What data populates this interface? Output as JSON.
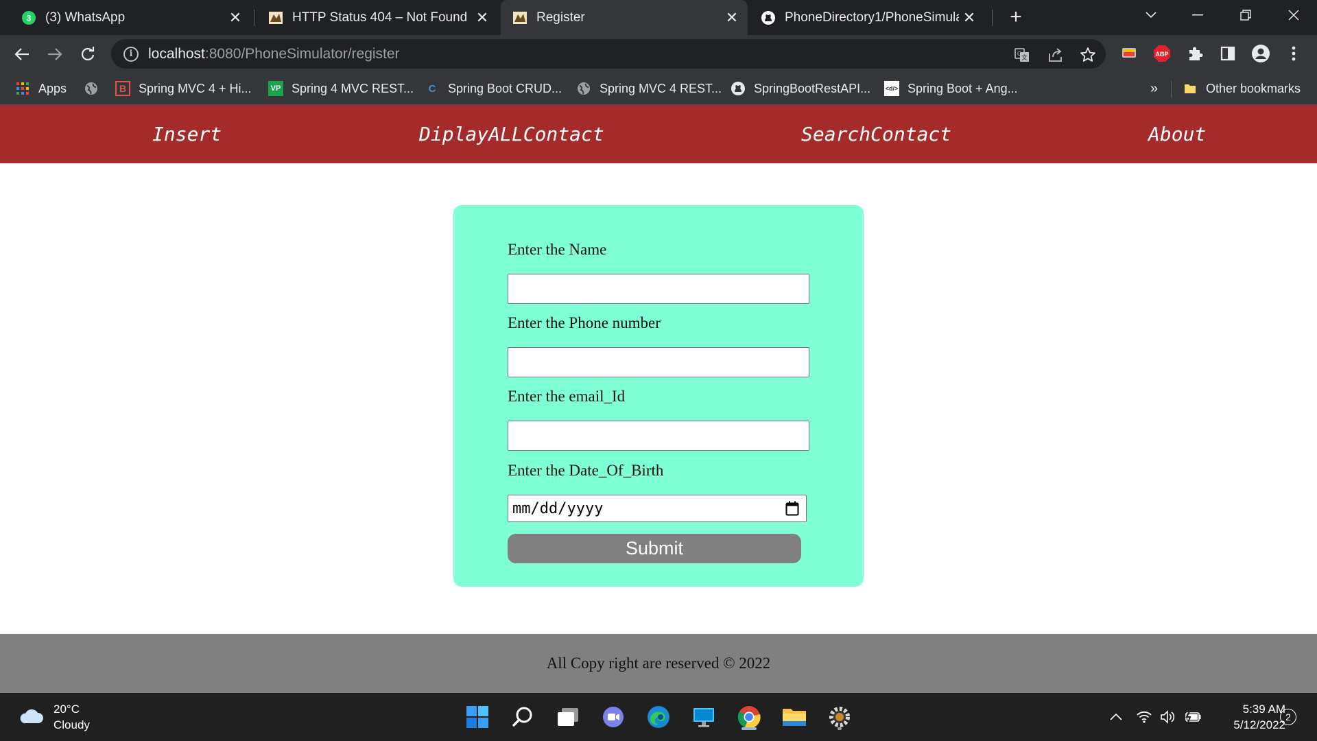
{
  "browser": {
    "tabs": [
      {
        "title": "(3) WhatsApp",
        "badge": "3",
        "favicon": "whatsapp-icon",
        "active": false
      },
      {
        "title": "HTTP Status 404 – Not Found",
        "favicon": "tomcat-icon",
        "active": false
      },
      {
        "title": "Register",
        "favicon": "tomcat-icon",
        "active": true
      },
      {
        "title": "PhoneDirectory1/PhoneSimulato",
        "favicon": "github-icon",
        "active": false
      }
    ],
    "url": {
      "host": "localhost",
      "rest": ":8080/PhoneSimulator/register"
    },
    "extensions": {
      "abp": "ABP"
    },
    "bookmarks": [
      {
        "label": "Apps",
        "icon": "apps-grid-icon"
      },
      {
        "label": "",
        "icon": "globe-icon"
      },
      {
        "label": "Spring MVC 4 + Hi...",
        "icon": "b-logo-icon",
        "glyph": "B"
      },
      {
        "label": "Spring 4 MVC REST...",
        "icon": "vp-logo-icon",
        "glyph": "VP"
      },
      {
        "label": "Spring Boot CRUD...",
        "icon": "c-logo-icon",
        "glyph": "C"
      },
      {
        "label": "Spring MVC 4 REST...",
        "icon": "globe-icon"
      },
      {
        "label": "SpringBootRestAPI...",
        "icon": "github-icon"
      },
      {
        "label": "Spring Boot + Ang...",
        "icon": "code-logo-icon",
        "glyph": "<d/>"
      }
    ],
    "more_bookmarks": "»",
    "other_bookmarks": "Other bookmarks"
  },
  "site": {
    "nav": [
      "Insert",
      "DiplayALLContact",
      "SearchContact",
      "About"
    ],
    "form": {
      "name_label": "Enter the Name",
      "phone_label": "Enter the Phone number",
      "email_label": "Enter the email_Id",
      "dob_label": "Enter the Date_Of_Birth",
      "dob_placeholder": "mm/dd/yyyy",
      "submit_label": "Submit"
    },
    "footer": "All Copy right are reserved © 2022"
  },
  "taskbar": {
    "weather": {
      "temp": "20°C",
      "condition": "Cloudy"
    },
    "clock": {
      "time": "5:39 AM",
      "date": "5/12/2022"
    },
    "notifications": "2"
  },
  "colors": {
    "site_nav": "#a52a2a",
    "form_bg": "#7fffd4",
    "footer_bg": "#808080",
    "submit_bg": "#808080"
  }
}
